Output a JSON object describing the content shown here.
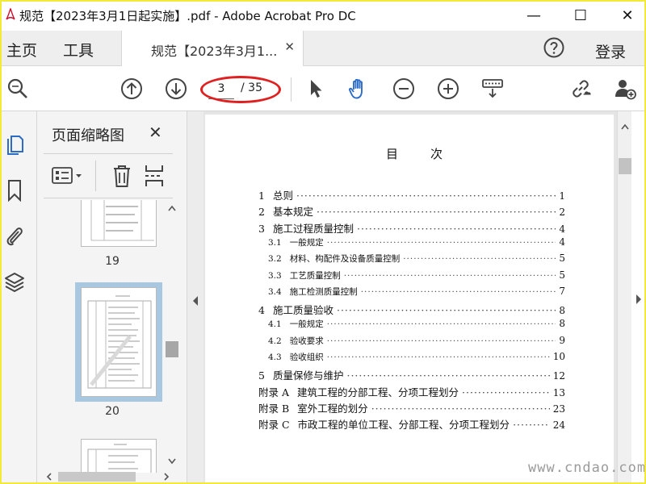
{
  "window": {
    "title": "规范【2023年3月1日起实施】.pdf - Adobe Acrobat Pro DC",
    "minimize": "—",
    "maximize": "☐",
    "close": "✕"
  },
  "menu": {
    "home": "主页",
    "tools": "工具",
    "doc_tab": "规范【2023年3月1...",
    "doc_tab_close": "✕",
    "help_icon": "help-circle-icon",
    "signin": "登录"
  },
  "toolbar": {
    "current_page": "3",
    "total_pages": "/ 35",
    "icons": [
      "zoom-search-icon",
      "page-up-icon",
      "page-down-icon",
      "select-cursor-icon",
      "hand-tool-icon",
      "zoom-out-icon",
      "zoom-in-icon",
      "keyboard-scroll-icon",
      "share-link-icon",
      "add-user-icon"
    ]
  },
  "sidebar": {
    "panel_title": "页面缩略图",
    "close": "✕",
    "thumbnails": [
      {
        "number": "19"
      },
      {
        "number": "20",
        "selected": true
      }
    ]
  },
  "document": {
    "heading": "目次",
    "toc": [
      {
        "level": 1,
        "num": "1",
        "title": "总则",
        "page": "1"
      },
      {
        "level": 1,
        "num": "2",
        "title": "基本规定",
        "page": "2"
      },
      {
        "level": 1,
        "num": "3",
        "title": "施工过程质量控制",
        "page": "4"
      },
      {
        "level": 2,
        "num": "3.1",
        "title": "一般规定",
        "page": "4"
      },
      {
        "level": 2,
        "num": "3.2",
        "title": "材料、构配件及设备质量控制",
        "page": "5"
      },
      {
        "level": 2,
        "num": "3.3",
        "title": "工艺质量控制",
        "page": "5"
      },
      {
        "level": 2,
        "num": "3.4",
        "title": "施工检测质量控制",
        "page": "7"
      },
      {
        "level": 1,
        "num": "4",
        "title": "施工质量验收",
        "page": "8"
      },
      {
        "level": 2,
        "num": "4.1",
        "title": "一般规定",
        "page": "8"
      },
      {
        "level": 2,
        "num": "4.2",
        "title": "验收要求",
        "page": "9"
      },
      {
        "level": 2,
        "num": "4.3",
        "title": "验收组织",
        "page": "10"
      },
      {
        "level": 1,
        "num": "5",
        "title": "质量保修与维护",
        "page": "12"
      },
      {
        "level": 1,
        "num": "附录 A",
        "title": "建筑工程的分部工程、分项工程划分",
        "page": "13"
      },
      {
        "level": 1,
        "num": "附录 B",
        "title": "室外工程的划分",
        "page": "23"
      },
      {
        "level": 1,
        "num": "附录 C",
        "title": "市政工程的单位工程、分部工程、分项工程划分",
        "page": "24"
      }
    ]
  },
  "watermark": "www.cndao.com",
  "colors": {
    "accent_blue": "#2d6cc6",
    "highlight_oval": "#e02020",
    "thumb_selected": "#a7c8e0",
    "frame_border": "#f2e93a"
  }
}
